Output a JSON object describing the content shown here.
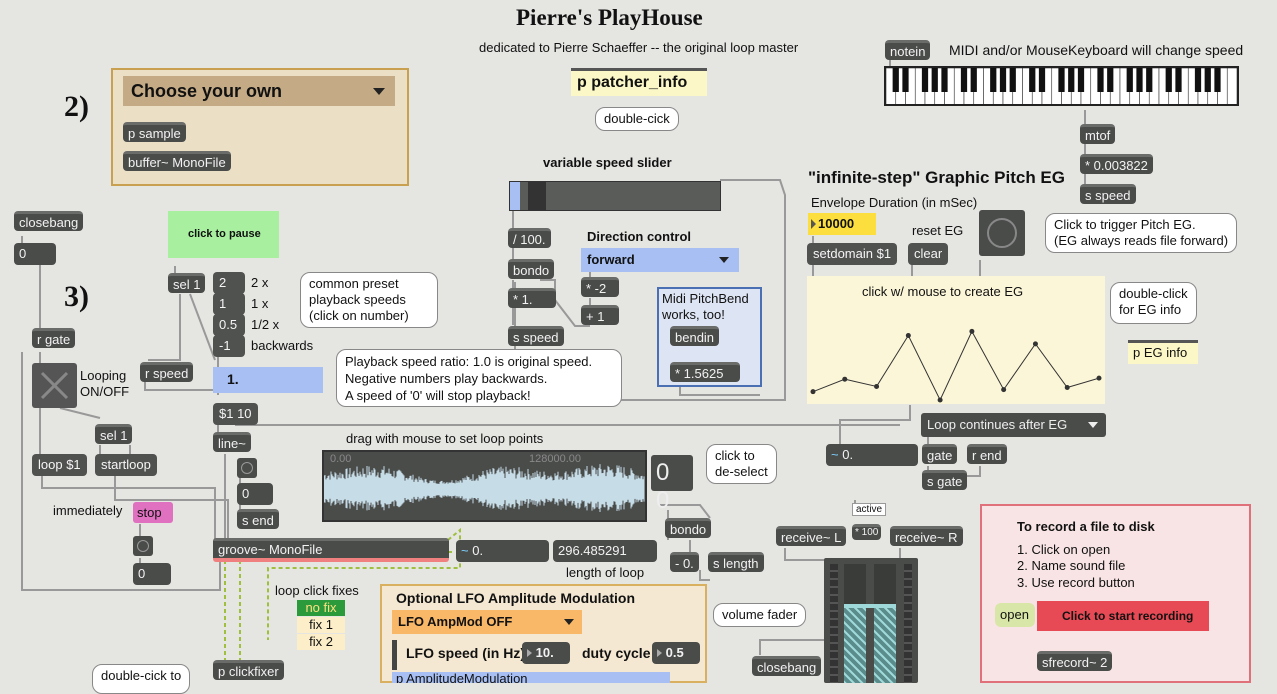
{
  "title": "Pierre's PlayHouse",
  "subtitle": "dedicated to Pierre Schaeffer -- the original loop master",
  "patcher_info": {
    "label": "p patcher_info",
    "hint": "double-cick"
  },
  "notein": {
    "label": "notein",
    "comment": "MIDI and/or MouseKeyboard will change speed"
  },
  "midi_chain": {
    "mtof": "mtof",
    "mult": "* 0.003822",
    "s_speed": "s speed"
  },
  "step2": {
    "number": "2)",
    "menu": "Choose your own",
    "p_sample": "p sample",
    "buffer": "buffer~ MonoFile"
  },
  "step3": {
    "number": "3)"
  },
  "closebang": {
    "label": "closebang",
    "num": "0"
  },
  "pause": {
    "label": "click to pause"
  },
  "sel1": "sel 1",
  "presets": {
    "values": [
      "2",
      "1",
      "0.5",
      "-1"
    ],
    "labels": [
      "2 x",
      "1 x",
      "1/2 x",
      "backwards"
    ],
    "bubble_lines": [
      "common preset",
      "playback speeds",
      "(click on number)"
    ]
  },
  "r_gate": "r gate",
  "looping": {
    "line1": "Looping",
    "line2": "ON/OFF"
  },
  "r_speed": "r speed",
  "speed_value": "1.",
  "speed_bubble": [
    "Playback speed ratio: 1.0 is original speed.",
    "Negative numbers play backwards.",
    "A speed of '0' will stop playback!"
  ],
  "line_msg": "$1 10",
  "line_obj": "line~",
  "sel1b": "sel 1",
  "loop_msg": "loop $1",
  "startloop": "startloop",
  "immediately": "immediately",
  "stop": "stop",
  "zero_a": "0",
  "zero_b": "0",
  "zero_c": "0",
  "s_end": "s end",
  "variable_speed": {
    "title": "variable speed slider",
    "div": "/ 100.",
    "bondo": "bondo",
    "mult": "* 1.",
    "s_speed": "s speed"
  },
  "direction": {
    "title": "Direction control",
    "menu": "forward",
    "neg": "* -2",
    "plus": "+ 1"
  },
  "pitchbend": {
    "line1": "Midi PitchBend",
    "line2": "works, too!",
    "bendin": "bendin",
    "mult": "* 1.5625"
  },
  "waveform": {
    "title": "drag with mouse to set loop points",
    "start": "0.00",
    "end": "128000.00",
    "display": "0 0",
    "bubble": [
      "click to",
      "de-select"
    ]
  },
  "groove": "groove~ MonoFile",
  "groove_num": "0.",
  "loop_length": {
    "value": "296.485291",
    "label": "length of loop"
  },
  "bondo2": "bondo",
  "minus0": "- 0.",
  "s_length": "s length",
  "pitch_eg": {
    "title": "\"infinite-step\" Graphic Pitch EG",
    "duration_label": "Envelope Duration (in mSec)",
    "duration": "10000",
    "setdomain": "setdomain $1",
    "reset_label": "reset EG",
    "clear": "clear",
    "trigger_bubble": [
      "Click to trigger Pitch EG.",
      "(EG always reads file forward)"
    ],
    "graph_label": "click w/ mouse to create EG",
    "info_bubble": [
      "double-click",
      "for EG info"
    ],
    "p_eg_info": "p EG info",
    "points": [
      0.08,
      0.2,
      0.13,
      0.62,
      0.0,
      0.66,
      0.1,
      0.54,
      0.12,
      0.21
    ]
  },
  "loop_after": {
    "menu": "Loop continues after EG",
    "num": "0.",
    "gate": "gate",
    "r_end": "r end",
    "s_gate": "s gate"
  },
  "audio": {
    "receive_l": "receive~ L",
    "receive_r": "receive~ R",
    "active": "active",
    "mult100": "* 100",
    "volume": "volume fader",
    "closebang": "closebang"
  },
  "record": {
    "title": "To record a file to disk",
    "steps": [
      "1. Click on open",
      "2. Name sound file",
      "3. Use record button"
    ],
    "open": "open",
    "start": "Click to start recording",
    "sfrecord": "sfrecord~ 2"
  },
  "loopfix": {
    "title": "loop click fixes",
    "items": [
      "no fix",
      "fix 1",
      "fix 2"
    ],
    "clickfixer": "p clickfixer"
  },
  "lfo": {
    "title": "Optional LFO Amplitude Modulation",
    "menu": "LFO AmpMod OFF",
    "speed_label": "LFO speed (in Hz)",
    "speed": "10.",
    "duty_label": "duty cycle",
    "duty": "0.5",
    "patcher": "p AmplitudeModulation"
  },
  "bottom_bubble": "double-cick to",
  "colors": {
    "background": "#e5e5e2",
    "object": "#4a4c4a",
    "pause": "#a8f0a0",
    "stop": "#e070c0",
    "record_panel": "#f8e4e4",
    "record_button": "#e84a55",
    "speed_num": "#a7bff2",
    "eg_bg": "#fbf6d8",
    "info_yellow": "#fbf7c6"
  }
}
